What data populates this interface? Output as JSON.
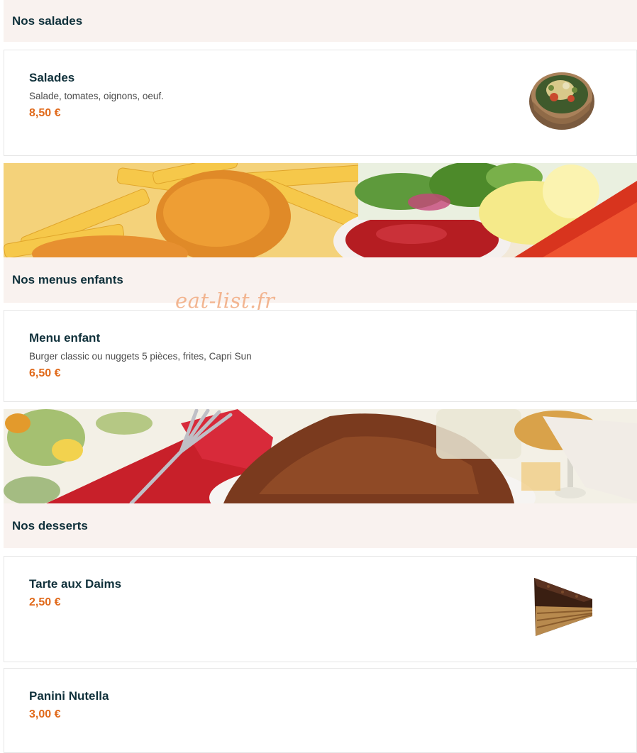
{
  "sections": {
    "salades": {
      "title": "Nos salades"
    },
    "menus_enfants": {
      "title": "Nos menus enfants"
    },
    "desserts": {
      "title": "Nos desserts"
    }
  },
  "items": {
    "salades": {
      "name": "Salades",
      "description": "Salade, tomates, oignons, oeuf.",
      "price": "8,50 €"
    },
    "menu_enfant": {
      "name": "Menu enfant",
      "description": "Burger classic ou nuggets 5 pièces, frites, Capri Sun",
      "price": "6,50 €"
    },
    "tarte_daims": {
      "name": "Tarte aux Daims",
      "price": "2,50 €"
    },
    "panini_nutella": {
      "name": "Panini Nutella",
      "price": "3,00 €"
    }
  },
  "watermark": "eat-list.fr",
  "colors": {
    "accent_price": "#e0691a",
    "header_bg": "#f9f2ef",
    "title": "#10313b"
  }
}
